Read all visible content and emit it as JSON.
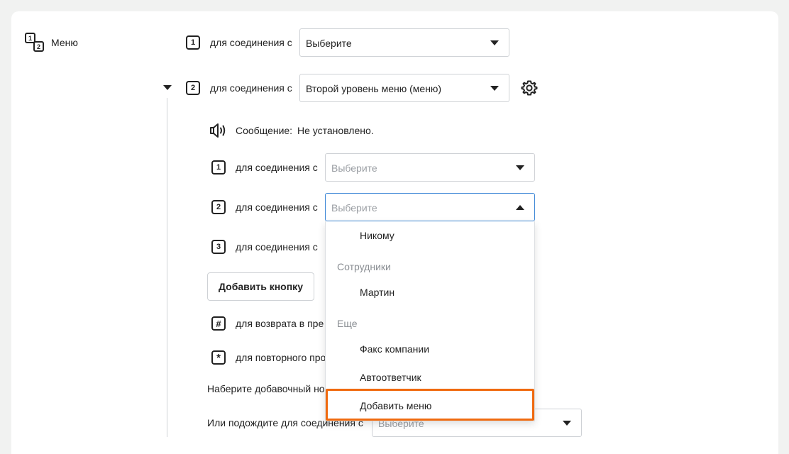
{
  "menu": {
    "title": "Меню",
    "icon": "numbered-menu-icon"
  },
  "top_rows": [
    {
      "key": "1",
      "label": "для соединения с",
      "value": "Выберите"
    },
    {
      "key": "2",
      "label": "для соединения с",
      "value": "Второй уровень меню (меню)"
    }
  ],
  "submenu": {
    "message_label": "Сообщение:",
    "message_value": "Не установлено.",
    "rows": [
      {
        "key": "1",
        "label": "для соединения с",
        "placeholder": "Выберите"
      },
      {
        "key": "2",
        "label": "для соединения с",
        "placeholder": "Выберите"
      },
      {
        "key": "3",
        "label": "для соединения с"
      }
    ],
    "add_button": "Добавить кнопку",
    "hash_row": {
      "key": "#",
      "label": "для возврата в пре"
    },
    "star_row": {
      "key": "*",
      "label": "для повторного про"
    },
    "dial_ext": "Наберите добавочный но",
    "wait_label": "Или подождите для соединения с",
    "wait_placeholder": "Выберите"
  },
  "dropdown": {
    "items": [
      {
        "type": "item",
        "label": "Никому"
      },
      {
        "type": "group",
        "label": "Сотрудники"
      },
      {
        "type": "item",
        "label": "Мартин"
      },
      {
        "type": "group",
        "label": "Еще"
      },
      {
        "type": "item",
        "label": "Факс компании"
      },
      {
        "type": "item",
        "label": "Автоответчик"
      },
      {
        "type": "item",
        "label": "Добавить меню",
        "highlighted": true
      }
    ]
  },
  "colors": {
    "accent_highlight": "#f06a0f",
    "focus_border": "#3d87d6",
    "background": "#f1f2f1"
  }
}
